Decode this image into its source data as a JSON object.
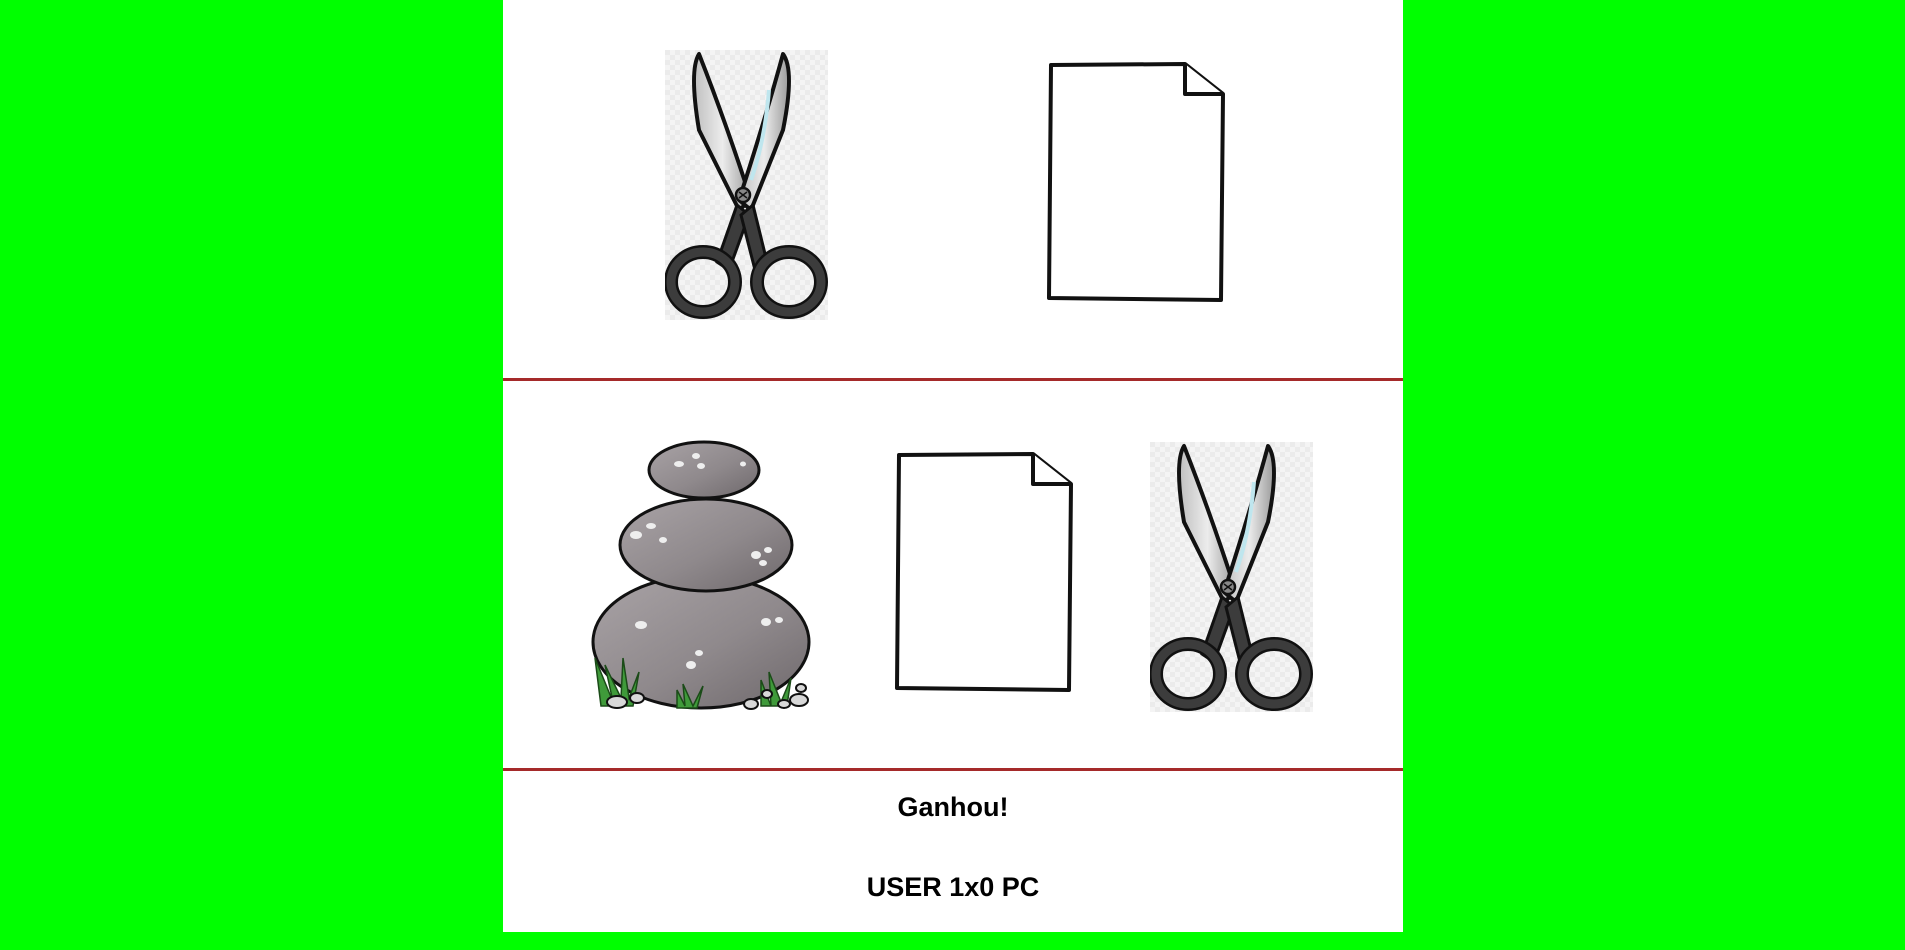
{
  "round": {
    "user_choice": "scissors",
    "pc_choice": "paper"
  },
  "options": [
    {
      "id": "rock",
      "icon": "rock-icon"
    },
    {
      "id": "paper",
      "icon": "paper-icon"
    },
    {
      "id": "scissors",
      "icon": "scissors-icon"
    }
  ],
  "result": {
    "message": "Ganhou!",
    "score_text": "USER 1x0 PC"
  },
  "colors": {
    "page_background": "#00ff00",
    "board_background": "#ffffff",
    "divider": "#a52a2a"
  }
}
